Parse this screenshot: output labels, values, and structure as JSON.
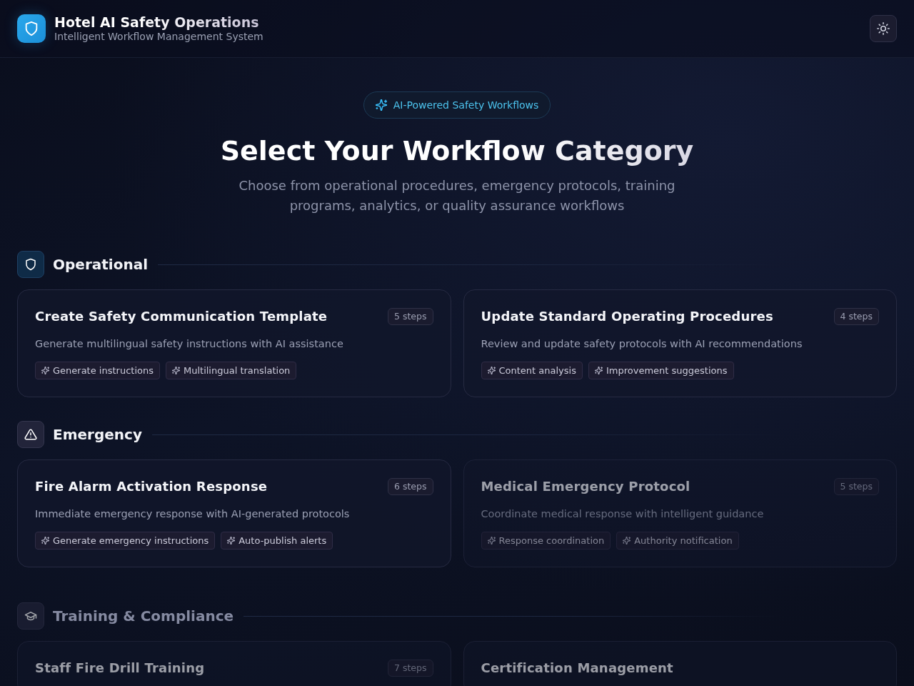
{
  "header": {
    "title": "Hotel AI Safety Operations",
    "subtitle": "Intelligent Workflow Management System"
  },
  "hero": {
    "badge": "AI-Powered Safety Workflows",
    "title": "Select Your Workflow Category",
    "description": "Choose from operational procedures, emergency protocols, training programs, analytics, or quality assurance workflows"
  },
  "sections": [
    {
      "title": "Operational",
      "kind": "shield",
      "dimmed": false,
      "workflows": [
        {
          "title": "Create Safety Communication Template",
          "steps": "5 steps",
          "description": "Generate multilingual safety instructions with AI assistance",
          "features": [
            "Generate instructions",
            "Multilingual translation"
          ],
          "dimmed": false
        },
        {
          "title": "Update Standard Operating Procedures",
          "steps": "4 steps",
          "description": "Review and update safety protocols with AI recommendations",
          "features": [
            "Content analysis",
            "Improvement suggestions"
          ],
          "dimmed": false
        }
      ]
    },
    {
      "title": "Emergency",
      "kind": "alert",
      "dimmed": false,
      "workflows": [
        {
          "title": "Fire Alarm Activation Response",
          "steps": "6 steps",
          "description": "Immediate emergency response with AI-generated protocols",
          "features": [
            "Generate emergency instructions",
            "Auto-publish alerts"
          ],
          "dimmed": false
        },
        {
          "title": "Medical Emergency Protocol",
          "steps": "5 steps",
          "description": "Coordinate medical response with intelligent guidance",
          "features": [
            "Response coordination",
            "Authority notification"
          ],
          "dimmed": true
        }
      ]
    },
    {
      "title": "Training & Compliance",
      "kind": "graduation",
      "dimmed": true,
      "workflows": [
        {
          "title": "Staff Fire Drill Training",
          "steps": "7 steps",
          "dimmed": true
        },
        {
          "title": "Certification Management",
          "dimmed": true
        }
      ]
    }
  ]
}
